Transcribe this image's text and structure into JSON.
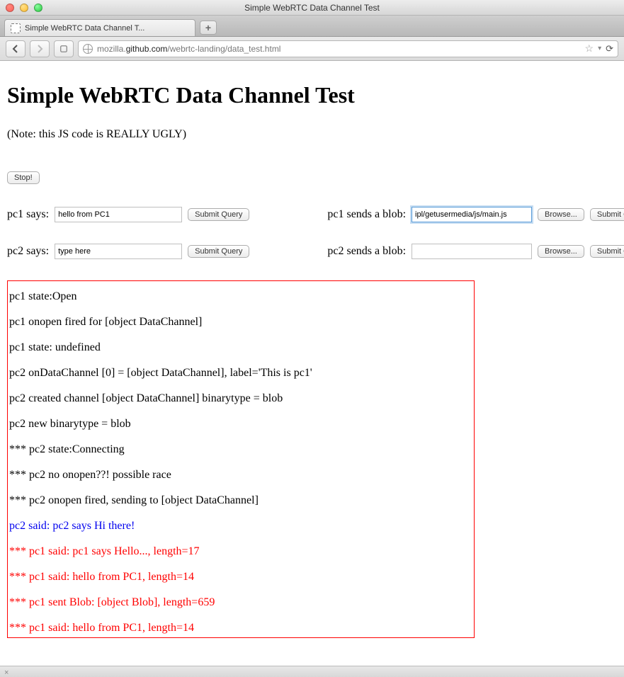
{
  "window_title": "Simple WebRTC Data Channel Test",
  "tab": {
    "title": "Simple WebRTC Data Channel T..."
  },
  "url": {
    "host": "mozilla.",
    "domain": "github.com",
    "path": "/webrtc-landing/data_test.html"
  },
  "page": {
    "heading": "Simple WebRTC Data Channel Test",
    "note": "(Note: this JS code is REALLY UGLY)",
    "stop_label": "Stop!",
    "submit_label": "Submit Query",
    "browse_label": "Browse...",
    "pc1_says_label": "pc1 says:",
    "pc2_says_label": "pc2 says:",
    "pc1_blob_label": "pc1 sends a blob:",
    "pc2_blob_label": "pc2 sends a blob:",
    "pc1_says_value": "hello from PC1",
    "pc2_says_value": "type here",
    "pc1_blob_value": "ipl/getusermedia/js/main.js",
    "pc2_blob_value": ""
  },
  "log": [
    {
      "text": "pc1 state:Open",
      "cls": ""
    },
    {
      "text": "pc1 onopen fired for [object DataChannel]",
      "cls": ""
    },
    {
      "text": "pc1 state: undefined",
      "cls": ""
    },
    {
      "text": "pc2 onDataChannel [0] = [object DataChannel], label='This is pc1'",
      "cls": ""
    },
    {
      "text": "pc2 created channel [object DataChannel] binarytype = blob",
      "cls": ""
    },
    {
      "text": "pc2 new binarytype = blob",
      "cls": ""
    },
    {
      "text": "*** pc2 state:Connecting",
      "cls": ""
    },
    {
      "text": "*** pc2 no onopen??! possible race",
      "cls": ""
    },
    {
      "text": "*** pc2 onopen fired, sending to [object DataChannel]",
      "cls": ""
    },
    {
      "text": "pc2 said: pc2 says Hi there!",
      "cls": "blue"
    },
    {
      "text": "*** pc1 said: pc1 says Hello..., length=17",
      "cls": "red"
    },
    {
      "text": "*** pc1 said: hello from PC1, length=14",
      "cls": "red"
    },
    {
      "text": "*** pc1 sent Blob: [object Blob], length=659",
      "cls": "red"
    },
    {
      "text": "*** pc1 said: hello from PC1, length=14",
      "cls": "red"
    }
  ]
}
